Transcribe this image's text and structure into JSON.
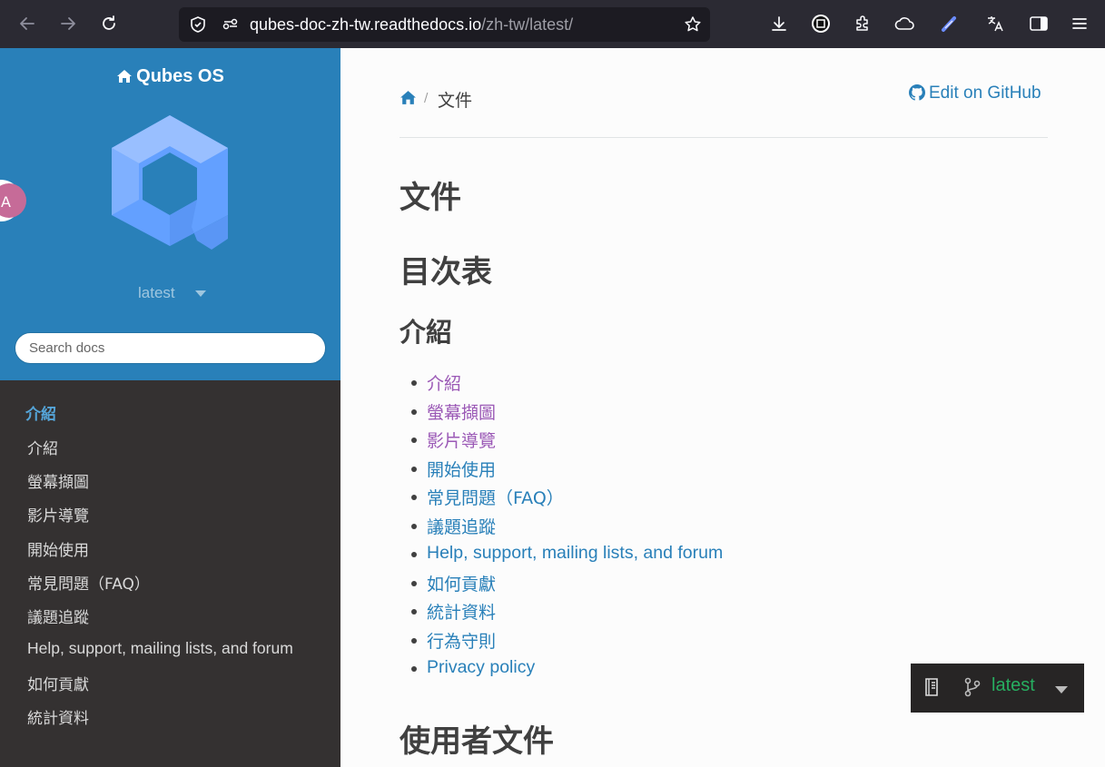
{
  "browser": {
    "url_host": "qubes-doc-zh-tw.readthedocs.io",
    "url_path": "/zh-tw/latest/"
  },
  "sidebar": {
    "project_name": "Qubes OS",
    "version": "latest",
    "search_placeholder": "Search docs",
    "caption": "介紹",
    "items": [
      {
        "label": "介紹"
      },
      {
        "label": "螢幕擷圖"
      },
      {
        "label": "影片導覽"
      },
      {
        "label": "開始使用"
      },
      {
        "label": "常見問題（FAQ）"
      },
      {
        "label": "議題追蹤"
      },
      {
        "label": "Help, support, mailing lists, and forum"
      },
      {
        "label": "如何貢獻"
      },
      {
        "label": "統計資料"
      }
    ]
  },
  "breadcrumb": {
    "current": "文件",
    "separator": "/",
    "edit_link": "Edit on GitHub"
  },
  "main": {
    "title": "文件",
    "toc_heading": "目次表",
    "section_intro": "介紹",
    "toc_items": [
      {
        "label": "介紹",
        "visited": true
      },
      {
        "label": "螢幕擷圖",
        "visited": true
      },
      {
        "label": "影片導覽",
        "visited": true
      },
      {
        "label": "開始使用",
        "visited": false
      },
      {
        "label": "常見問題（FAQ）",
        "visited": false
      },
      {
        "label": "議題追蹤",
        "visited": false
      },
      {
        "label": "Help, support, mailing lists, and forum",
        "visited": false
      },
      {
        "label": "如何貢獻",
        "visited": false
      },
      {
        "label": "統計資料",
        "visited": false
      },
      {
        "label": "行為守則",
        "visited": false
      },
      {
        "label": "Privacy policy",
        "visited": false
      }
    ],
    "next_section": "使用者文件"
  },
  "flyout": {
    "version": "latest"
  },
  "colors": {
    "sidebar_blue": "#2980b9",
    "sidebar_dark": "#343131",
    "link": "#2980b9",
    "visited": "#9b59b6",
    "version_green": "#27ae60"
  }
}
